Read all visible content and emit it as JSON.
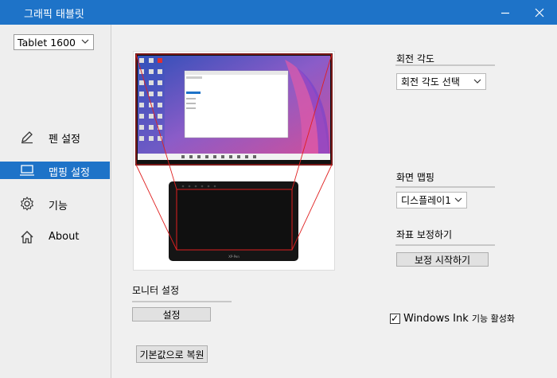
{
  "window": {
    "title": "그래픽 태블릿"
  },
  "device": {
    "selected": "Tablet 1600"
  },
  "sidebar": {
    "items": [
      {
        "label": "펜 설정"
      },
      {
        "label": "맵핑 설정"
      },
      {
        "label": "기능"
      },
      {
        "label": "About"
      }
    ]
  },
  "rotation": {
    "label": "회전 각도",
    "selected": "회전 각도 선택"
  },
  "screen_mapping": {
    "label": "화면 맵핑",
    "selected": "디스플레이1"
  },
  "calibration": {
    "label": "좌표 보정하기",
    "button": "보정 시작하기"
  },
  "monitor": {
    "label": "모니터 설정",
    "button": "설정"
  },
  "windows_ink": {
    "checked": true,
    "label": "Windows Ink",
    "sub": "기능 활성화"
  },
  "restore": {
    "button": "기본값으로 복원"
  },
  "preview": {
    "brand": "XP-Pen"
  },
  "colors": {
    "accent": "#1e73c8",
    "mapping_line": "#e02020"
  }
}
